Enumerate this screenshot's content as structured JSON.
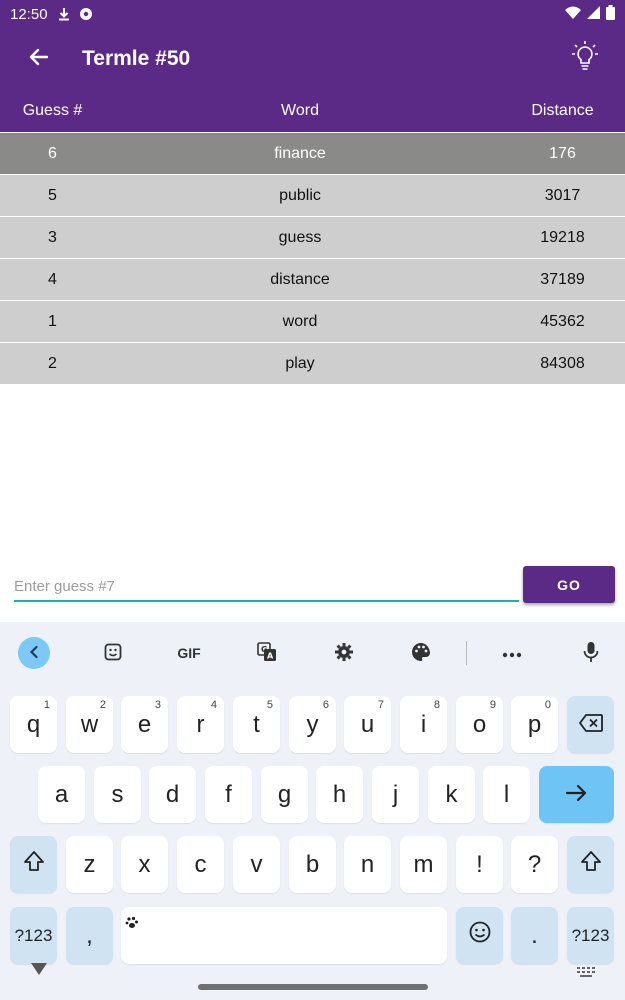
{
  "status_bar": {
    "time": "12:50",
    "left_icons": [
      "download-icon",
      "media-icon"
    ],
    "right_icons": [
      "wifi-icon",
      "signal-icon",
      "battery-icon"
    ]
  },
  "app_bar": {
    "title": "Termle #50",
    "back_icon": "arrow-left-icon",
    "hint_icon": "lightbulb-icon"
  },
  "table": {
    "headers": [
      "Guess #",
      "Word",
      "Distance"
    ],
    "rows": [
      {
        "guess": "6",
        "word": "finance",
        "distance": "176"
      },
      {
        "guess": "5",
        "word": "public",
        "distance": "3017"
      },
      {
        "guess": "3",
        "word": "guess",
        "distance": "19218"
      },
      {
        "guess": "4",
        "word": "distance",
        "distance": "37189"
      },
      {
        "guess": "1",
        "word": "word",
        "distance": "45362"
      },
      {
        "guess": "2",
        "word": "play",
        "distance": "84308"
      }
    ]
  },
  "guess_input": {
    "placeholder": "Enter guess #7",
    "value": ""
  },
  "go_button": {
    "label": "GO"
  },
  "keyboard": {
    "toolbar": {
      "gif_label": "GIF"
    },
    "row1": [
      {
        "key": "q",
        "sup": "1"
      },
      {
        "key": "w",
        "sup": "2"
      },
      {
        "key": "e",
        "sup": "3"
      },
      {
        "key": "r",
        "sup": "4"
      },
      {
        "key": "t",
        "sup": "5"
      },
      {
        "key": "y",
        "sup": "6"
      },
      {
        "key": "u",
        "sup": "7"
      },
      {
        "key": "i",
        "sup": "8"
      },
      {
        "key": "o",
        "sup": "9"
      },
      {
        "key": "p",
        "sup": "0"
      }
    ],
    "row2": [
      "a",
      "s",
      "d",
      "f",
      "g",
      "h",
      "j",
      "k",
      "l"
    ],
    "row3": [
      "z",
      "x",
      "c",
      "v",
      "b",
      "n",
      "m",
      "!",
      "?"
    ],
    "symbols_label": "?123",
    "comma_label": ",",
    "period_label": "."
  },
  "colors": {
    "primary": "#5b2a86",
    "accent": "#16b4a8",
    "top_row": "#8a8a88",
    "row_bg": "#cecece",
    "enter_key": "#6ec4f4"
  }
}
